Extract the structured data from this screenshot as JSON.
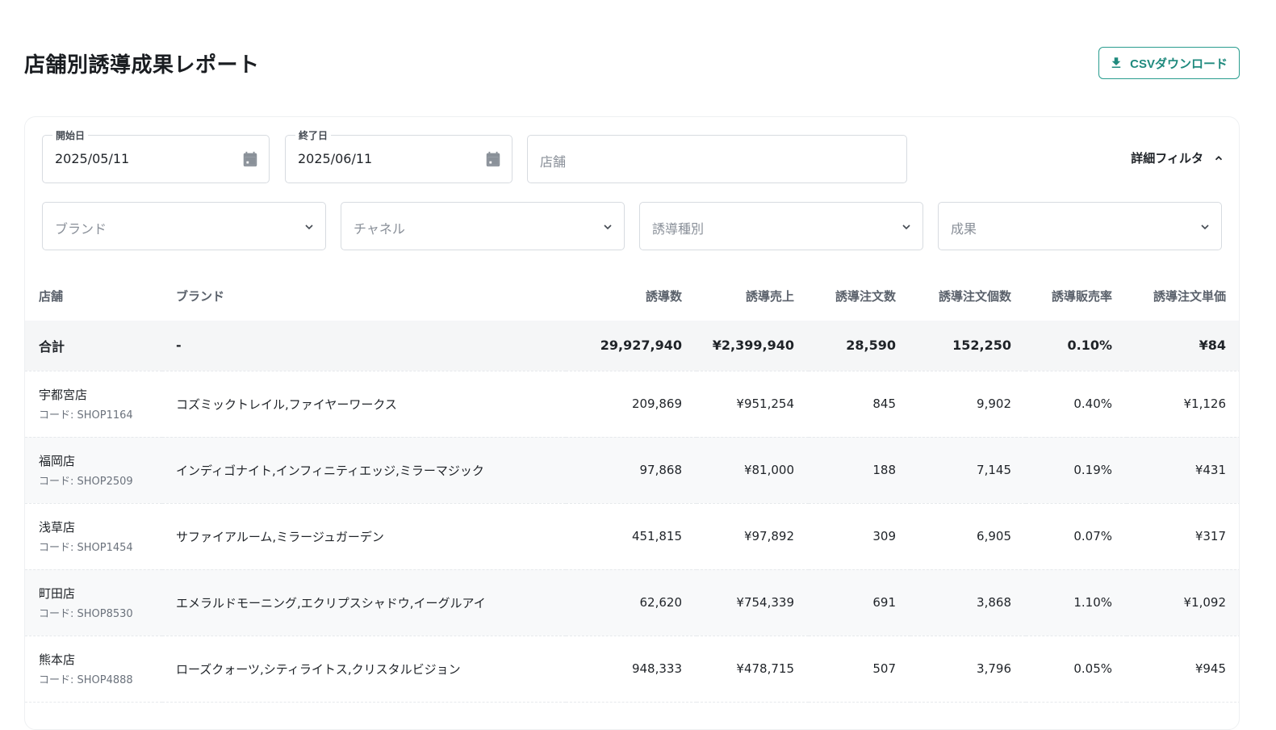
{
  "page": {
    "title": "店舗別誘導成果レポート",
    "csv_button_label": "CSVダウンロード"
  },
  "filters": {
    "start_date": {
      "label": "開始日",
      "value": "2025/05/11"
    },
    "end_date": {
      "label": "終了日",
      "value": "2025/06/11"
    },
    "store": {
      "placeholder": "店舗"
    },
    "detail_filter_label": "詳細フィルタ",
    "brand": {
      "placeholder": "ブランド"
    },
    "channel": {
      "placeholder": "チャネル"
    },
    "guide_type": {
      "placeholder": "誘導種別"
    },
    "result": {
      "placeholder": "成果"
    }
  },
  "table": {
    "headers": [
      "店舗",
      "ブランド",
      "誘導数",
      "誘導売上",
      "誘導注文数",
      "誘導注文個数",
      "誘導販売率",
      "誘導注文単価"
    ],
    "total": {
      "label": "合計",
      "brand": "-",
      "guides": "29,927,940",
      "sales": "¥2,399,940",
      "orders": "28,590",
      "items": "152,250",
      "rate": "0.10%",
      "unit_price": "¥84"
    },
    "rows": [
      {
        "store": "宇都宮店",
        "code": "コード: SHOP1164",
        "brands": "コズミックトレイル,ファイヤーワークス",
        "guides": "209,869",
        "sales": "¥951,254",
        "orders": "845",
        "items": "9,902",
        "rate": "0.40%",
        "unit_price": "¥1,126"
      },
      {
        "store": "福岡店",
        "code": "コード: SHOP2509",
        "brands": "インディゴナイト,インフィニティエッジ,ミラーマジック",
        "guides": "97,868",
        "sales": "¥81,000",
        "orders": "188",
        "items": "7,145",
        "rate": "0.19%",
        "unit_price": "¥431"
      },
      {
        "store": "浅草店",
        "code": "コード: SHOP1454",
        "brands": "サファイアルーム,ミラージュガーデン",
        "guides": "451,815",
        "sales": "¥97,892",
        "orders": "309",
        "items": "6,905",
        "rate": "0.07%",
        "unit_price": "¥317"
      },
      {
        "store": "町田店",
        "code": "コード: SHOP8530",
        "brands": "エメラルドモーニング,エクリプスシャドウ,イーグルアイ",
        "guides": "62,620",
        "sales": "¥754,339",
        "orders": "691",
        "items": "3,868",
        "rate": "1.10%",
        "unit_price": "¥1,092"
      },
      {
        "store": "熊本店",
        "code": "コード: SHOP4888",
        "brands": "ローズクォーツ,シティライトス,クリスタルビジョン",
        "guides": "948,333",
        "sales": "¥478,715",
        "orders": "507",
        "items": "3,796",
        "rate": "0.05%",
        "unit_price": "¥945"
      }
    ]
  },
  "colors": {
    "accent": "#2a9d8f",
    "calendar_icon": "#8a9199"
  }
}
